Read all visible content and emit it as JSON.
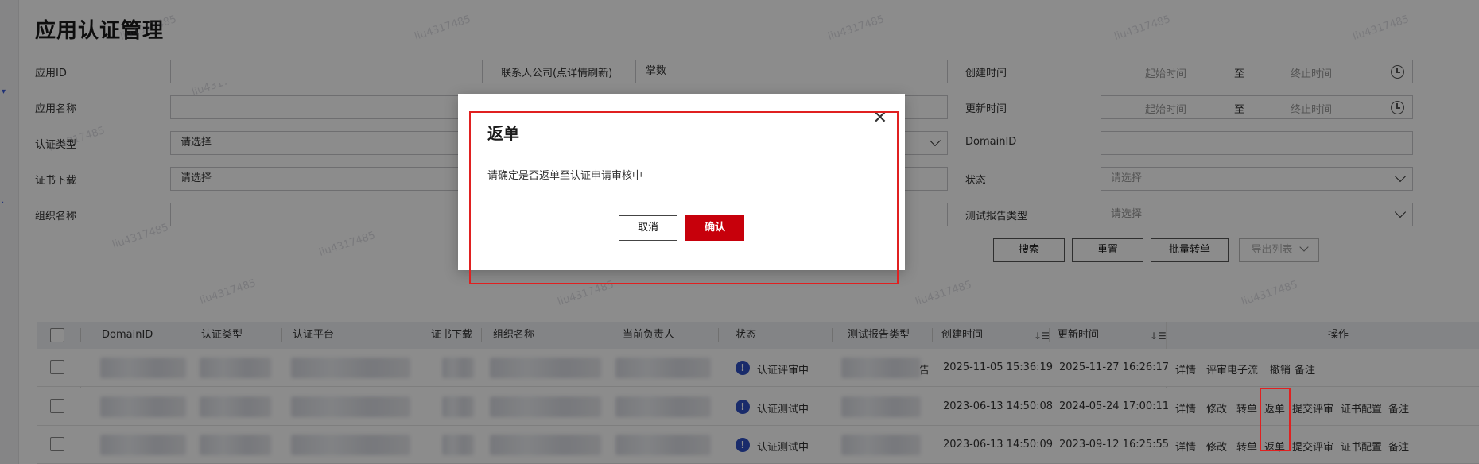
{
  "page": {
    "title": "应用认证管理",
    "watermark": "liu4317485"
  },
  "filters": {
    "app_id": {
      "label": "应用ID",
      "value": ""
    },
    "contact_company": {
      "label": "联系人公司(点详情刷新)",
      "value": "掌数"
    },
    "created_time": {
      "label": "创建时间",
      "start_placeholder": "起始时间",
      "separator": "至",
      "end_placeholder": "终止时间"
    },
    "app_name": {
      "label": "应用名称",
      "value": ""
    },
    "updated_time": {
      "label": "更新时间",
      "start_placeholder": "起始时间",
      "separator": "至",
      "end_placeholder": "终止时间"
    },
    "auth_type": {
      "label": "认证类型",
      "value": "请选择"
    },
    "domain_id": {
      "label": "DomainID",
      "value": ""
    },
    "cert_download": {
      "label": "证书下载",
      "value": "请选择"
    },
    "status": {
      "label": "状态",
      "placeholder": "请选择"
    },
    "org_name": {
      "label": "组织名称",
      "value": ""
    },
    "report_type": {
      "label": "测试报告类型",
      "placeholder": "请选择"
    }
  },
  "actions": {
    "search": "搜索",
    "reset": "重置",
    "batch_transfer": "批量转单",
    "export_list": "导出列表"
  },
  "table": {
    "columns": [
      "DomainID",
      "认证类型",
      "认证平台",
      "证书下载",
      "组织名称",
      "当前负责人",
      "状态",
      "测试报告类型",
      "创建时间",
      "更新时间",
      "操作"
    ],
    "rows": [
      {
        "status": "认证评审中",
        "created": "2025-11-05 15:36:19",
        "updated": "2025-11-27 16:26:17",
        "report_suffix": "告",
        "ops": [
          "详情",
          "评审电子流",
          "撤销",
          "备注"
        ]
      },
      {
        "status": "认证测试中",
        "created": "2023-06-13 14:50:08",
        "updated": "2024-05-24 17:00:11",
        "report_suffix": "",
        "ops": [
          "详情",
          "修改",
          "转单",
          "返单",
          "提交评审",
          "证书配置",
          "备注"
        ]
      },
      {
        "status": "认证测试中",
        "created": "2023-06-13 14:50:09",
        "updated": "2023-09-12 16:25:55",
        "report_suffix": "",
        "ops": [
          "详情",
          "修改",
          "转单",
          "返单",
          "提交评审",
          "证书配置",
          "备注"
        ]
      }
    ]
  },
  "modal": {
    "title": "返单",
    "message": "请确定是否返单至认证申请审核中",
    "cancel": "取消",
    "confirm": "确认",
    "close_icon": "close-icon"
  },
  "colors": {
    "primary_red": "#c7000b",
    "highlight_red": "#e02020",
    "status_blue": "#2f4fc4"
  }
}
